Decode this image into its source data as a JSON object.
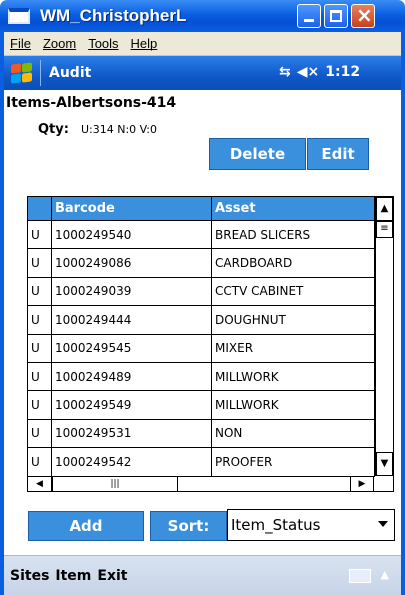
{
  "window": {
    "title": "WM_ChristopherL"
  },
  "menu": [
    "File",
    "Zoom",
    "Tools",
    "Help"
  ],
  "taskbar": {
    "app_title": "Audit",
    "time": "1:12"
  },
  "screen": {
    "title": "Items-Albertsons-414",
    "qty_label": "Qty:",
    "qty_value": "U:314 N:0 V:0",
    "delete_label": "Delete",
    "edit_label": "Edit"
  },
  "grid": {
    "headers": [
      "",
      "Barcode",
      "Asset"
    ],
    "rows": [
      {
        "status": "U",
        "barcode": "1000249540",
        "asset": "BREAD SLICERS"
      },
      {
        "status": "U",
        "barcode": "1000249086",
        "asset": "CARDBOARD"
      },
      {
        "status": "U",
        "barcode": "1000249039",
        "asset": "CCTV CABINET"
      },
      {
        "status": "U",
        "barcode": "1000249444",
        "asset": "DOUGHNUT"
      },
      {
        "status": "U",
        "barcode": "1000249545",
        "asset": "MIXER"
      },
      {
        "status": "U",
        "barcode": "1000249489",
        "asset": "MILLWORK"
      },
      {
        "status": "U",
        "barcode": "1000249549",
        "asset": "MILLWORK"
      },
      {
        "status": "U",
        "barcode": "1000249531",
        "asset": "NON"
      },
      {
        "status": "U",
        "barcode": "1000249542",
        "asset": "PROOFER"
      }
    ]
  },
  "footer": {
    "add_label": "Add",
    "sort_label": "Sort:",
    "sort_value": "Item_Status"
  },
  "softkeys": [
    "Sites",
    "Item",
    "Exit"
  ],
  "colors": {
    "accent": "#3a90dd",
    "titlebar": "#0a5fe0"
  }
}
